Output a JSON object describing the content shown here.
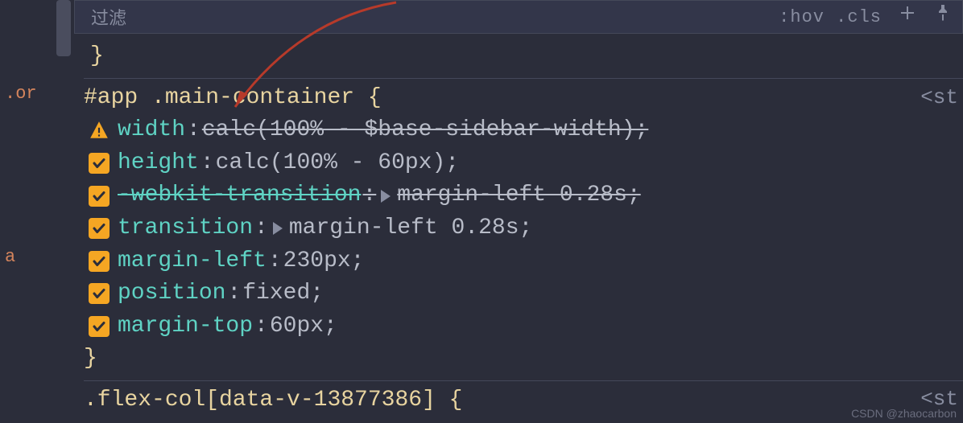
{
  "gutter": {
    "line1": ".or",
    "line2": "a"
  },
  "toolbar": {
    "filter_placeholder": "过滤",
    "right_label": ":hov  .cls",
    "plus": "+"
  },
  "top_close": "}",
  "selector1": "#app .main-container {",
  "st_label": "<st",
  "rules": [
    {
      "icon": "warning",
      "prop": "width",
      "val": "calc(100% - $base-sidebar-width);",
      "propStrike": false,
      "valStrike": true
    },
    {
      "icon": "check",
      "prop": "height",
      "val": "calc(100% - 60px);",
      "propStrike": false,
      "valStrike": false
    },
    {
      "icon": "check",
      "prop": "-webkit-transition",
      "val": "margin-left 0.28s;",
      "propStrike": true,
      "valStrike": true,
      "expand": true
    },
    {
      "icon": "check",
      "prop": "transition",
      "val": "margin-left 0.28s;",
      "propStrike": false,
      "valStrike": false,
      "expand": true
    },
    {
      "icon": "check",
      "prop": "margin-left",
      "val": "230px;",
      "propStrike": false,
      "valStrike": false
    },
    {
      "icon": "check",
      "prop": "position",
      "val": "fixed;",
      "propStrike": false,
      "valStrike": false
    },
    {
      "icon": "check",
      "prop": "margin-top",
      "val": "60px;",
      "propStrike": false,
      "valStrike": false
    }
  ],
  "close1": "}",
  "selector2": ".flex-col[data-v-13877386] {",
  "st_label2": "<st",
  "watermark": "CSDN @zhaocarbon"
}
